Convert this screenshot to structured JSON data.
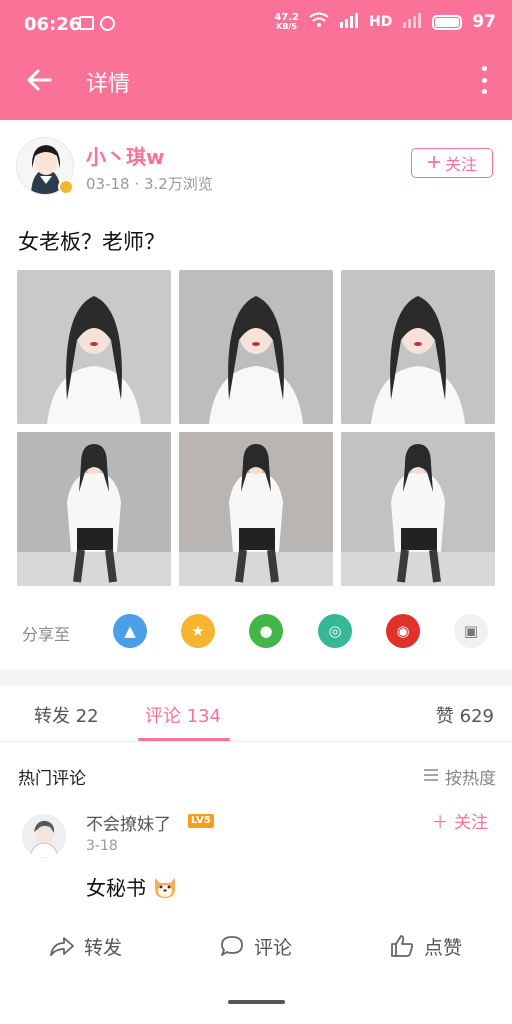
{
  "status_bar": {
    "time": "06:26",
    "net_speed": "47.2",
    "net_unit": "KB/S",
    "signal_1": "4G",
    "hd_label": "HD",
    "battery_level": 0.97,
    "battery": "97"
  },
  "header": {
    "title": "详情",
    "back_icon": "arrow-left-icon",
    "more_icon": "more-vertical-icon",
    "bg_color": "#fb7299"
  },
  "author": {
    "name": "小丶琪w",
    "date": "03-18",
    "views": "3.2万浏览",
    "separator": "·",
    "follow_label": "关注",
    "accent_color": "#fb7299"
  },
  "post": {
    "title": "女老板？老师？",
    "photo_count": 6
  },
  "share": {
    "label": "分享至",
    "targets": [
      {
        "name": "qq-icon",
        "color": "#4a9fe9",
        "glyph": "▲"
      },
      {
        "name": "qzone-icon",
        "color": "#f6b431",
        "glyph": "★"
      },
      {
        "name": "wechat-icon",
        "color": "#44b549",
        "glyph": "●"
      },
      {
        "name": "moments-icon",
        "color": "#37b894",
        "glyph": "◎"
      },
      {
        "name": "weibo-icon",
        "color": "#e0322b",
        "glyph": "◉"
      },
      {
        "name": "gallery-icon",
        "color": "#f1f1f1",
        "glyph": "▣"
      }
    ]
  },
  "tabs": {
    "repost": "转发 22",
    "comment": "评论 134",
    "likes": "赞 629"
  },
  "comments_section": {
    "hot_label": "热门评论",
    "sort_label": "按热度",
    "items": [
      {
        "user": "不会撩妹了",
        "level": "LV5",
        "follow_label": "关注",
        "time": "3-18",
        "text": "女秘书"
      }
    ]
  },
  "bottom_bar": {
    "repost": "转发",
    "comment": "评论",
    "like": "点赞"
  }
}
